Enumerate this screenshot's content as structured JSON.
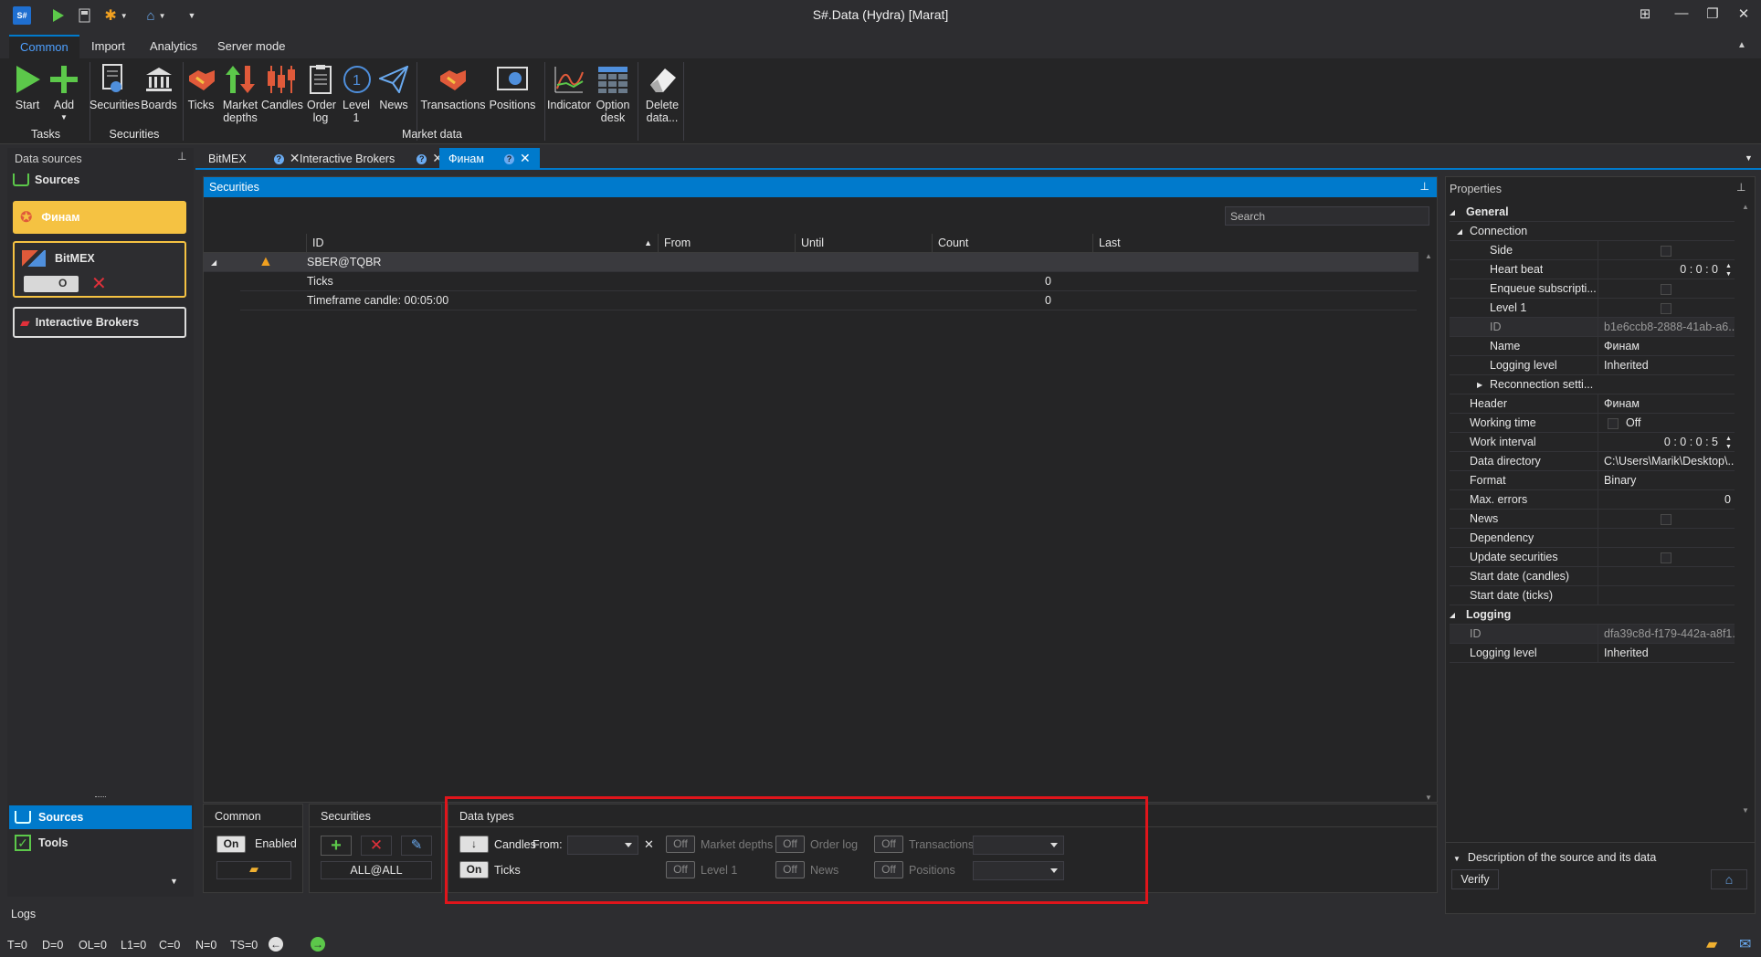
{
  "window": {
    "title": "S#.Data (Hydra) [Marat]",
    "app_icon": "S#"
  },
  "ribbon_tabs": [
    "Common",
    "Import",
    "Analytics",
    "Server mode"
  ],
  "ribbon": {
    "tasks": {
      "start": "Start",
      "add": "Add",
      "group": "Tasks"
    },
    "securities": {
      "securities": "Securities",
      "boards": "Boards",
      "group": "Securities"
    },
    "market_data": {
      "ticks": "Ticks",
      "market_depths": "Market depths",
      "candles": "Candles",
      "order_log": "Order log",
      "level1": "Level 1",
      "news": "News",
      "transactions": "Transactions",
      "positions": "Positions",
      "group": "Market data"
    },
    "other": {
      "indicator": "Indicator",
      "option_desk": "Option desk",
      "delete_data": "Delete data..."
    }
  },
  "left_panel": {
    "title": "Data sources",
    "sources_header": "Sources",
    "sources": [
      {
        "name": "Финам",
        "color": "#f5c242"
      },
      {
        "name": "BitMEX",
        "toggle": "O"
      },
      {
        "name": "Interactive Brokers"
      }
    ],
    "nav": [
      {
        "label": "Sources"
      },
      {
        "label": "Tools"
      }
    ]
  },
  "doc_tabs": [
    {
      "label": "BitMEX"
    },
    {
      "label": "Interactive Brokers"
    },
    {
      "label": "Финам"
    }
  ],
  "securities_panel": {
    "title": "Securities",
    "search_placeholder": "Search",
    "columns": [
      "ID",
      "From",
      "Until",
      "Count",
      "Last"
    ],
    "rows": [
      {
        "id": "SBER@TQBR",
        "count": ""
      },
      {
        "id": "Ticks",
        "count": "0"
      },
      {
        "id": "Timeframe candle: 00:05:00",
        "count": "0"
      }
    ]
  },
  "bottom": {
    "common": {
      "title": "Common",
      "toggle": "On",
      "label": "Enabled"
    },
    "securities": {
      "title": "Securities",
      "all": "ALL@ALL"
    },
    "data_types": {
      "title": "Data types",
      "candles_btn": "↓",
      "candles": "Candles",
      "from": "From:",
      "ticks_toggle": "On",
      "ticks": "Ticks",
      "market_depths_toggle": "Off",
      "market_depths": "Market depths",
      "order_log_toggle": "Off",
      "order_log": "Order log",
      "transactions_toggle": "Off",
      "transactions": "Transactions",
      "level1_toggle": "Off",
      "level1": "Level 1",
      "news_toggle": "Off",
      "news": "News",
      "positions_toggle": "Off",
      "positions": "Positions"
    }
  },
  "properties": {
    "title": "Properties",
    "rows": [
      {
        "name": "General",
        "value": ""
      },
      {
        "name": "Connection",
        "value": ""
      },
      {
        "name": "Side",
        "value": ""
      },
      {
        "name": "Heart beat",
        "value": "0 : 0 : 0"
      },
      {
        "name": "Enqueue subscripti...",
        "value": ""
      },
      {
        "name": "Level 1",
        "value": ""
      },
      {
        "name": "ID",
        "value": "b1e6ccb8-2888-41ab-a6..."
      },
      {
        "name": "Name",
        "value": "Финам"
      },
      {
        "name": "Logging level",
        "value": "Inherited"
      },
      {
        "name": "Reconnection setti...",
        "value": ""
      },
      {
        "name": "Header",
        "value": "Финам"
      },
      {
        "name": "Working time",
        "value": "Off"
      },
      {
        "name": "Work interval",
        "value": "0 : 0 : 0 : 5"
      },
      {
        "name": "Data directory",
        "value": "C:\\Users\\Marik\\Desktop\\..."
      },
      {
        "name": "Format",
        "value": "Binary"
      },
      {
        "name": "Max. errors",
        "value": "0"
      },
      {
        "name": "News",
        "value": ""
      },
      {
        "name": "Dependency",
        "value": ""
      },
      {
        "name": "Update securities",
        "value": ""
      },
      {
        "name": "Start date (candles)",
        "value": ""
      },
      {
        "name": "Start date (ticks)",
        "value": ""
      },
      {
        "name": "Logging",
        "value": ""
      },
      {
        "name": "ID",
        "value": "dfa39c8d-f179-442a-a8f1..."
      },
      {
        "name": "Logging level",
        "value": "Inherited"
      }
    ],
    "description": "Description of the source and its data",
    "verify": "Verify"
  },
  "logs": {
    "title": "Logs"
  },
  "status": [
    "T=0",
    "D=0",
    "OL=0",
    "L1=0",
    "C=0",
    "N=0",
    "TS=0"
  ],
  "colors": {
    "accent": "#007acc",
    "highlight": "#f5c242",
    "annotation": "#e0151b"
  }
}
